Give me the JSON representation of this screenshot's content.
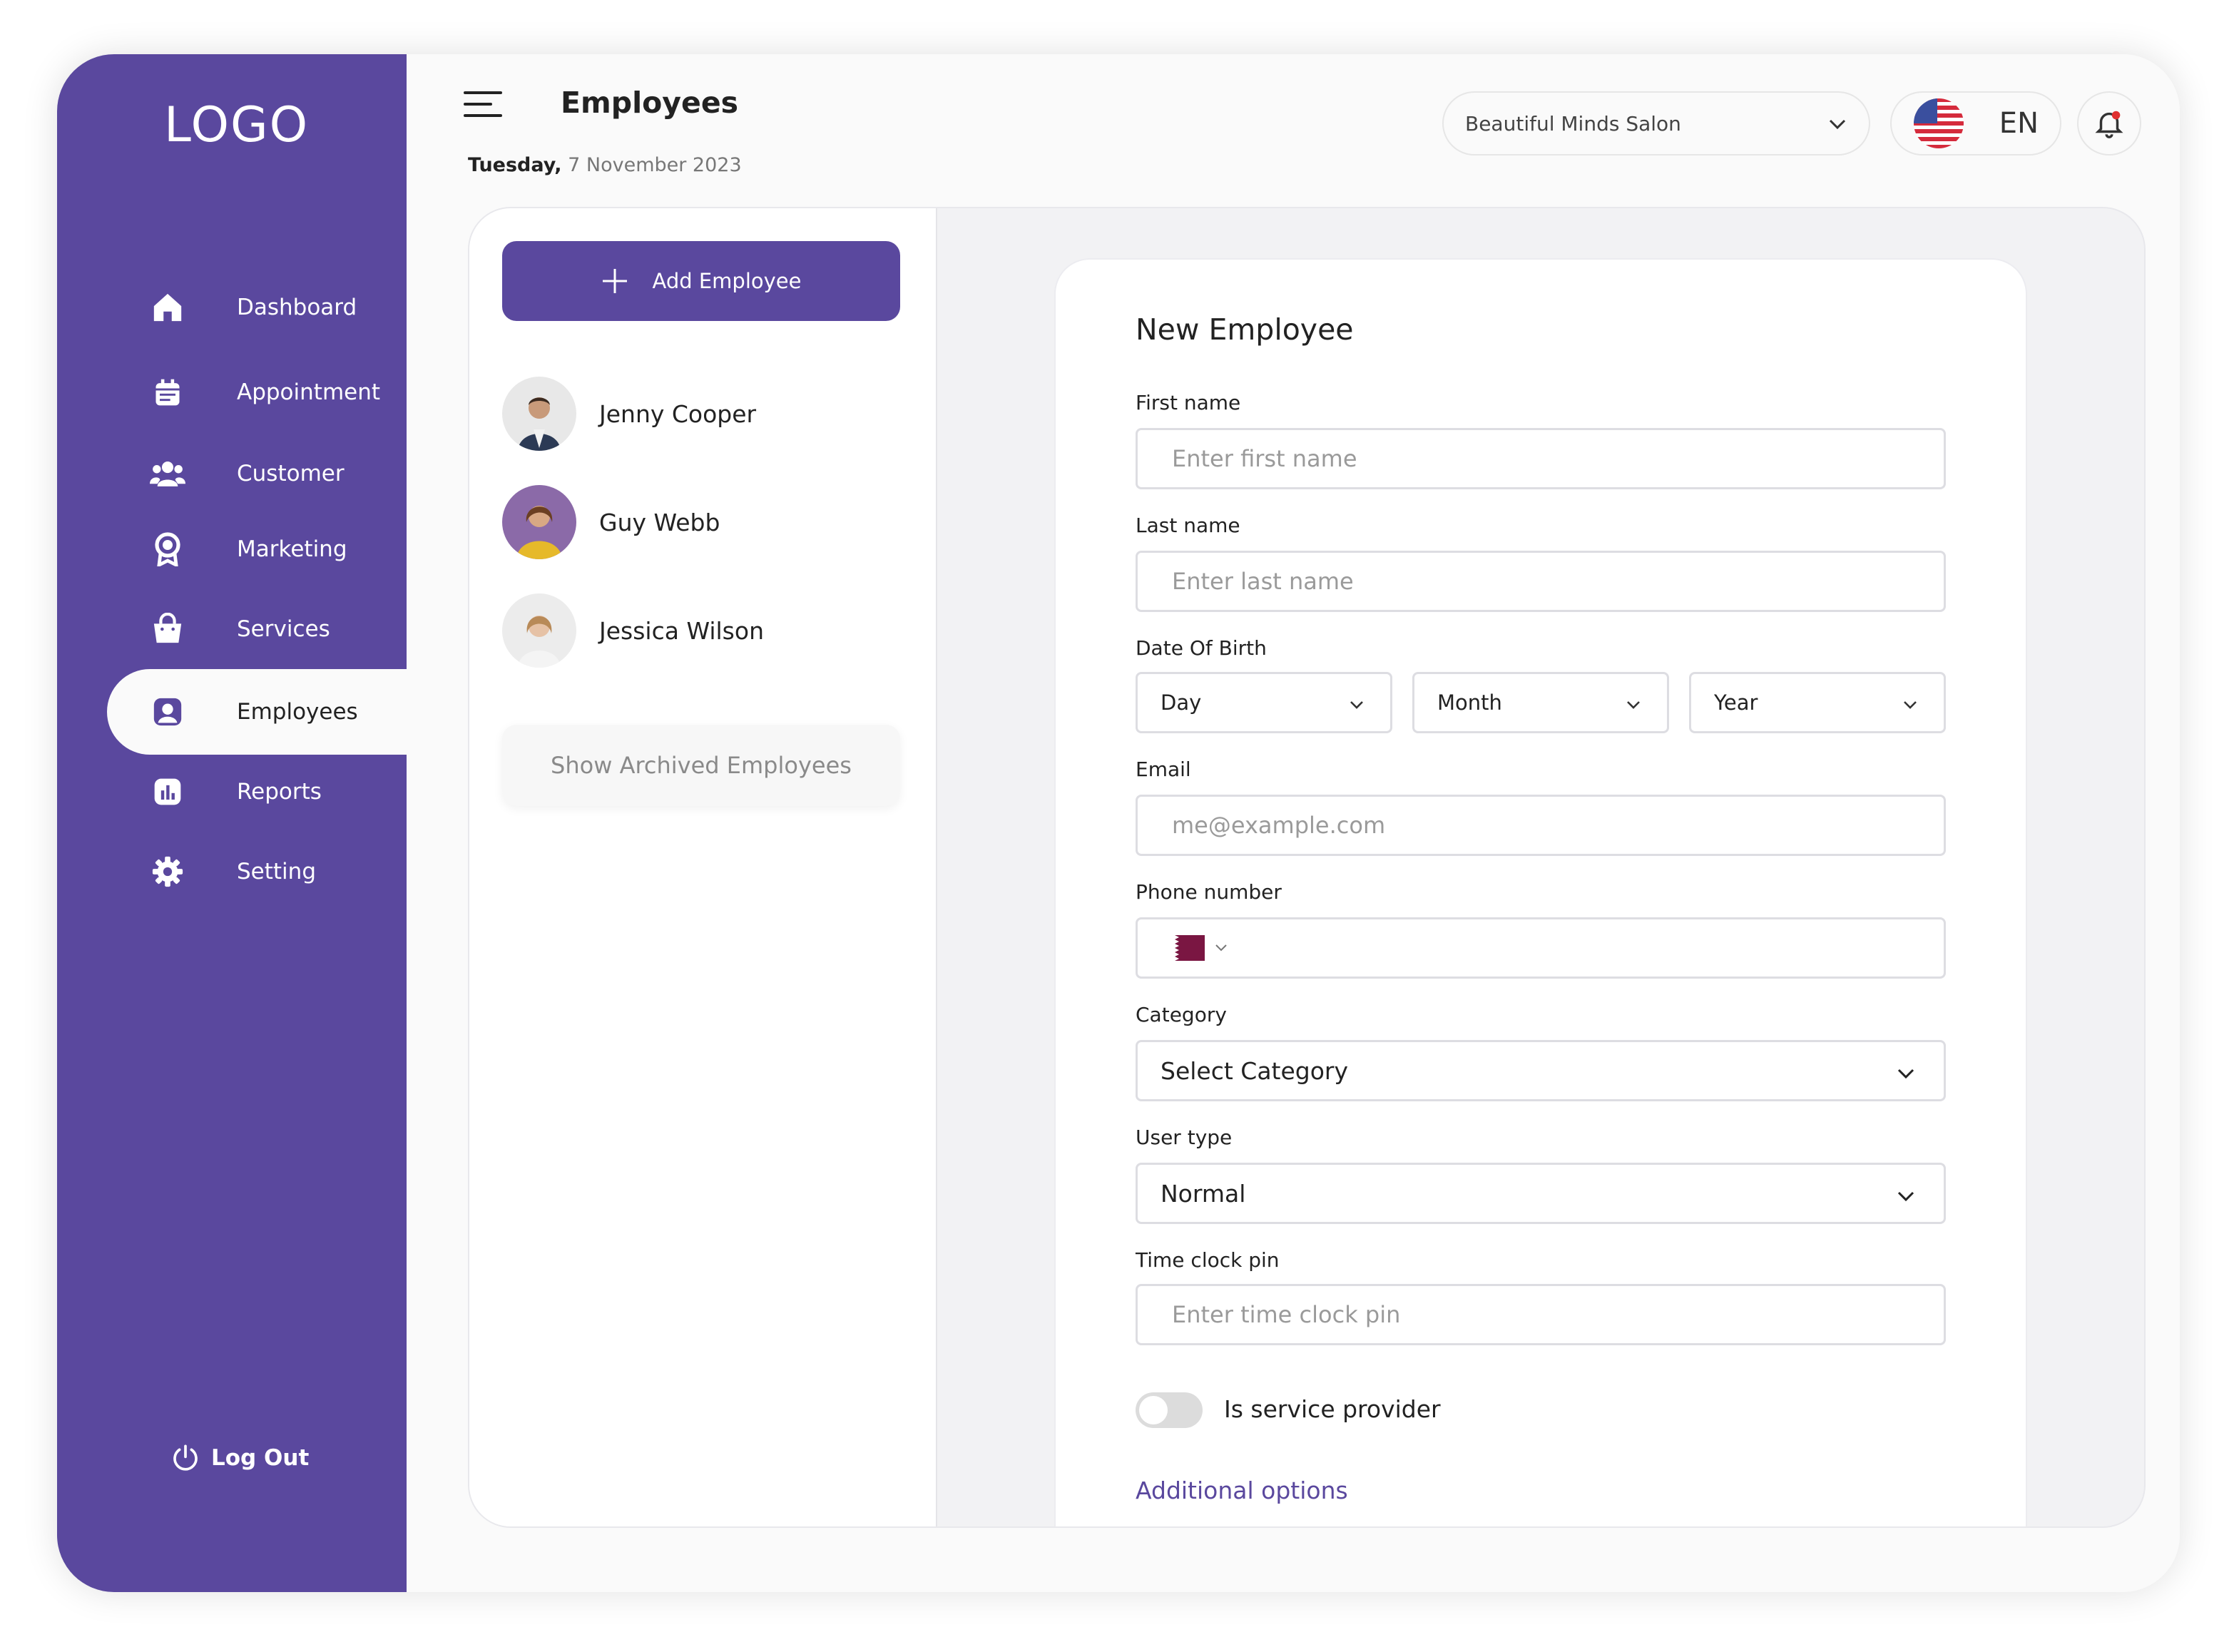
{
  "sidebar": {
    "logo": "LOGO",
    "items": [
      {
        "label": "Dashboard",
        "icon": "home-icon"
      },
      {
        "label": "Appointment",
        "icon": "calendar-icon"
      },
      {
        "label": "Customer",
        "icon": "users-icon"
      },
      {
        "label": "Marketing",
        "icon": "badge-icon"
      },
      {
        "label": "Services",
        "icon": "bag-icon"
      },
      {
        "label": "Employees",
        "icon": "employee-icon",
        "active": true
      },
      {
        "label": "Reports",
        "icon": "chart-icon"
      },
      {
        "label": "Setting",
        "icon": "gear-icon"
      }
    ],
    "logout": "Log Out",
    "accent_color": "#5a489e"
  },
  "header": {
    "title": "Employees",
    "date_day": "Tuesday,",
    "date_rest": " 7 November 2023",
    "salon": "Beautiful Minds Salon",
    "language": "EN"
  },
  "employees": {
    "add_label": "Add Employee",
    "list": [
      {
        "name": "Jenny Cooper"
      },
      {
        "name": "Guy Webb"
      },
      {
        "name": "Jessica Wilson"
      }
    ],
    "archived_label": "Show Archived Employees"
  },
  "form": {
    "title": "New Employee",
    "first_name_label": "First name",
    "first_name_placeholder": "Enter first name",
    "last_name_label": "Last name",
    "last_name_placeholder": "Enter last name",
    "dob_label": "Date Of Birth",
    "dob_day": "Day",
    "dob_month": "Month",
    "dob_year": "Year",
    "email_label": "Email",
    "email_placeholder": "me@example.com",
    "phone_label": "Phone number",
    "category_label": "Category",
    "category_value": "Select Category",
    "user_type_label": "User type",
    "user_type_value": "Normal",
    "pin_label": "Time clock pin",
    "pin_placeholder": "Enter time clock pin",
    "service_provider_label": "Is service provider",
    "service_provider_on": false,
    "additional_label": "Additional options"
  }
}
